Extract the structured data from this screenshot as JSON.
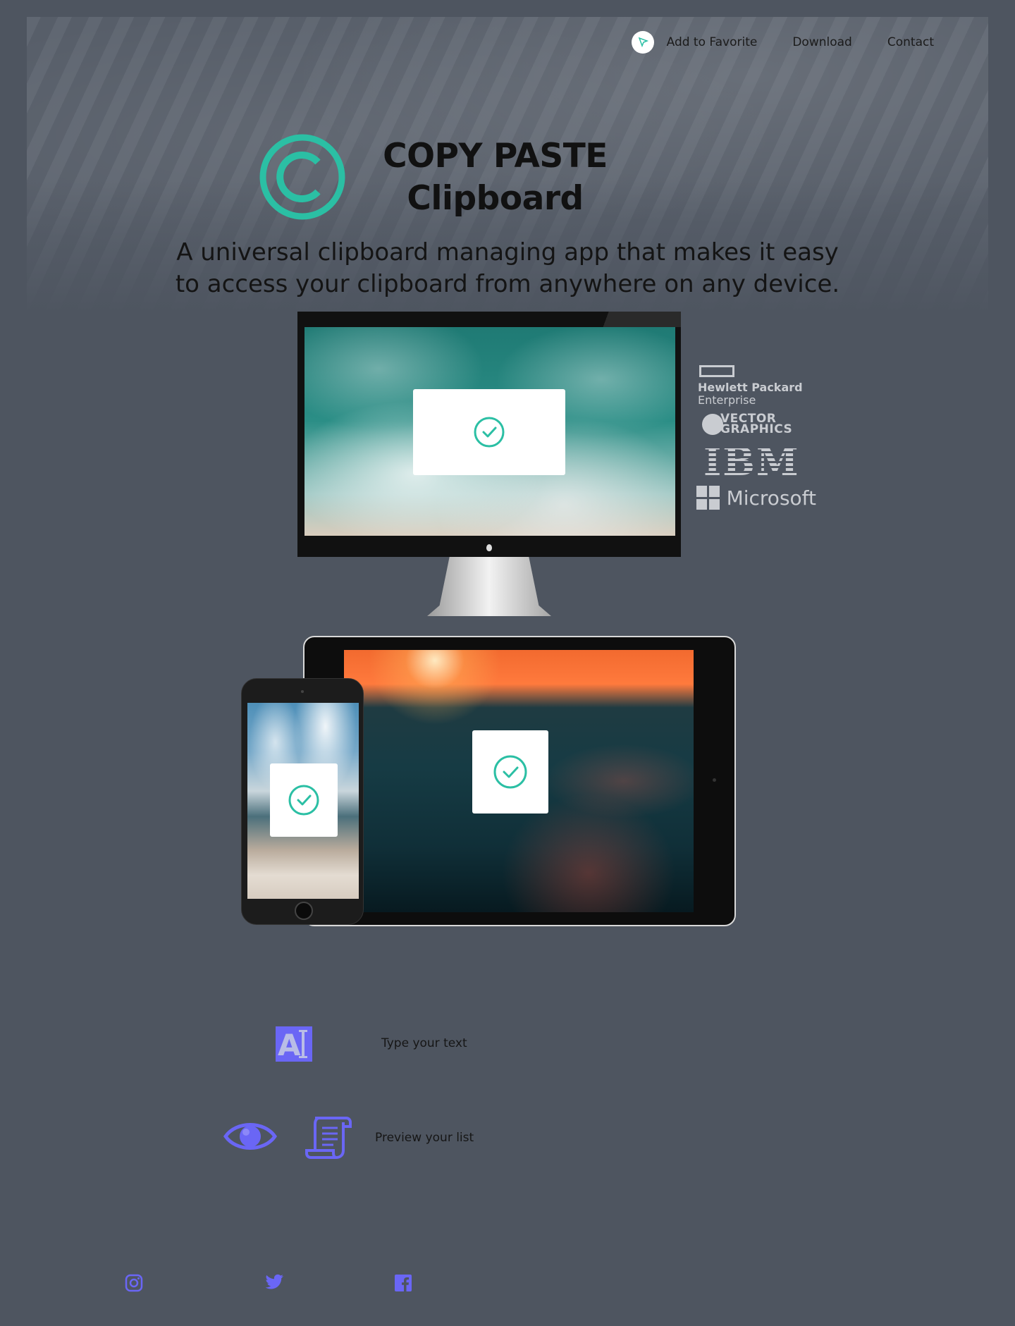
{
  "nav": {
    "favorite": "Add to Favorite",
    "download": "Download",
    "contact": "Contact"
  },
  "hero": {
    "title_line1": "COPY PASTE",
    "title_line2": "Clipboard",
    "subtitle_line1": "A universal clipboard managing app that makes it easy",
    "subtitle_line2": "to access your clipboard from anywhere on any device."
  },
  "brands": {
    "hpe_line1": "Hewlett Packard",
    "hpe_line2": "Enterprise",
    "vector_line1": "VECTOR",
    "vector_line2": "GRAPHICS",
    "ibm": "IBM",
    "microsoft": "Microsoft"
  },
  "features": [
    {
      "text": "Type your text",
      "icon": "text-cursor-icon"
    },
    {
      "text": "Preview your list",
      "icon": "eye-icon"
    }
  ],
  "social": [
    "instagram-icon",
    "twitter-icon",
    "facebook-icon"
  ],
  "colors": {
    "background": "#4e5560",
    "accent_teal": "#2bbfa4",
    "feature_icon": "#6a66f5",
    "brand_logo_gray": "#c9ccd1"
  }
}
